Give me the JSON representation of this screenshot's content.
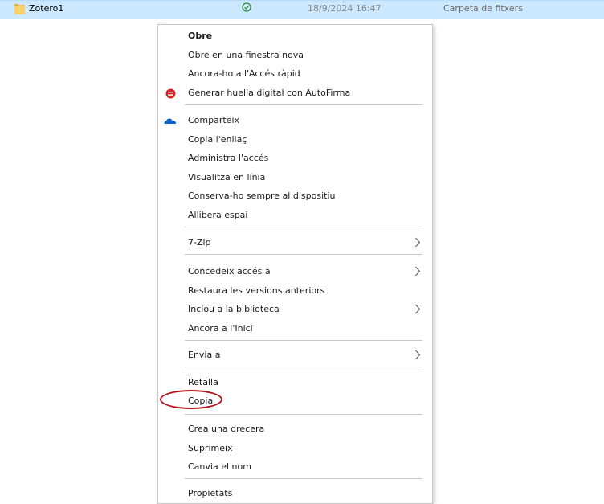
{
  "file_row": {
    "name": "Zotero1",
    "date": "18/9/2024 16:47",
    "type": "Carpeta de fitxers"
  },
  "menu": {
    "items": [
      {
        "label": "Obre",
        "bold": true
      },
      {
        "label": "Obre en una finestra nova"
      },
      {
        "label": "Ancora-ho a l'Accés ràpid"
      },
      {
        "label": "Generar huella digital con AutoFirma",
        "icon": "autofirma-icon"
      },
      {
        "label": "Comparteix",
        "icon": "onedrive-cloud-icon"
      },
      {
        "label": "Copia l'enllaç"
      },
      {
        "label": "Administra l'accés"
      },
      {
        "label": "Visualitza en línia"
      },
      {
        "label": "Conserva-ho sempre al dispositiu"
      },
      {
        "label": "Allibera espai"
      },
      {
        "label": "7-Zip",
        "submenu": true
      },
      {
        "label": "Concedeix accés a",
        "submenu": true
      },
      {
        "label": "Restaura les versions anteriors"
      },
      {
        "label": "Inclou a la biblioteca",
        "submenu": true
      },
      {
        "label": "Ancora a l'Inici"
      },
      {
        "label": "Envia a",
        "submenu": true
      },
      {
        "label": "Retalla"
      },
      {
        "label": "Copia",
        "annotated": true
      },
      {
        "label": "Crea una drecera"
      },
      {
        "label": "Suprimeix"
      },
      {
        "label": "Canvia el nom"
      },
      {
        "label": "Propietats"
      }
    ]
  },
  "colors": {
    "selection": "#cce8ff",
    "annotation": "#b5121b",
    "onedrive": "#0a64c8",
    "autofirma": "#d42323"
  }
}
